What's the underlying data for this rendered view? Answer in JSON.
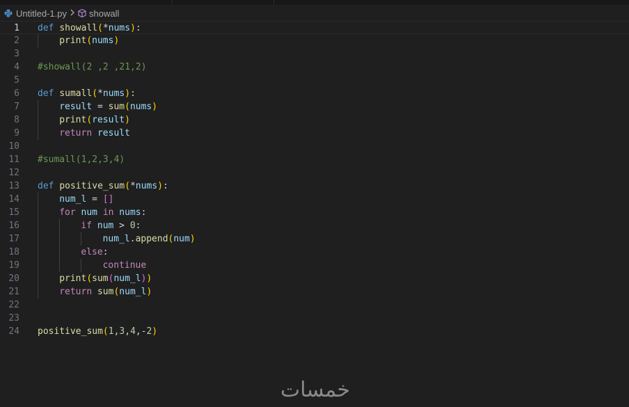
{
  "breadcrumb": {
    "file": "Untitled-1.py",
    "symbol": "showall"
  },
  "editor": {
    "current_line": 1,
    "lines": [
      {
        "n": "1",
        "tokens": [
          [
            "kw",
            "def"
          ],
          [
            "pl",
            " "
          ],
          [
            "fn",
            "showall"
          ],
          [
            "br1",
            "("
          ],
          [
            "pl",
            "*"
          ],
          [
            "var",
            "nums"
          ],
          [
            "br1",
            ")"
          ],
          [
            "pl",
            ":"
          ]
        ]
      },
      {
        "n": "2",
        "indent": 1,
        "tokens": [
          [
            "fn",
            "print"
          ],
          [
            "br1",
            "("
          ],
          [
            "var",
            "nums"
          ],
          [
            "br1",
            ")"
          ]
        ]
      },
      {
        "n": "3",
        "tokens": []
      },
      {
        "n": "4",
        "tokens": [
          [
            "cmt",
            "#showall(2 ,2 ,21,2)"
          ]
        ]
      },
      {
        "n": "5",
        "tokens": []
      },
      {
        "n": "6",
        "tokens": [
          [
            "kw",
            "def"
          ],
          [
            "pl",
            " "
          ],
          [
            "fn",
            "sumall"
          ],
          [
            "br1",
            "("
          ],
          [
            "pl",
            "*"
          ],
          [
            "var",
            "nums"
          ],
          [
            "br1",
            ")"
          ],
          [
            "pl",
            ":"
          ]
        ]
      },
      {
        "n": "7",
        "indent": 1,
        "tokens": [
          [
            "var",
            "result"
          ],
          [
            "pl",
            " = "
          ],
          [
            "fn",
            "sum"
          ],
          [
            "br1",
            "("
          ],
          [
            "var",
            "nums"
          ],
          [
            "br1",
            ")"
          ]
        ]
      },
      {
        "n": "8",
        "indent": 1,
        "tokens": [
          [
            "fn",
            "print"
          ],
          [
            "br1",
            "("
          ],
          [
            "var",
            "result"
          ],
          [
            "br1",
            ")"
          ]
        ]
      },
      {
        "n": "9",
        "indent": 1,
        "tokens": [
          [
            "ctl",
            "return"
          ],
          [
            "pl",
            " "
          ],
          [
            "var",
            "result"
          ]
        ]
      },
      {
        "n": "10",
        "tokens": []
      },
      {
        "n": "11",
        "tokens": [
          [
            "cmt",
            "#sumall(1,2,3,4)"
          ]
        ]
      },
      {
        "n": "12",
        "tokens": []
      },
      {
        "n": "13",
        "tokens": [
          [
            "kw",
            "def"
          ],
          [
            "pl",
            " "
          ],
          [
            "fn",
            "positive_sum"
          ],
          [
            "br1",
            "("
          ],
          [
            "pl",
            "*"
          ],
          [
            "var",
            "nums"
          ],
          [
            "br1",
            ")"
          ],
          [
            "pl",
            ":"
          ]
        ]
      },
      {
        "n": "14",
        "indent": 1,
        "tokens": [
          [
            "var",
            "num_l"
          ],
          [
            "pl",
            " = "
          ],
          [
            "br2",
            "[]"
          ]
        ]
      },
      {
        "n": "15",
        "indent": 1,
        "tokens": [
          [
            "ctl",
            "for"
          ],
          [
            "pl",
            " "
          ],
          [
            "var",
            "num"
          ],
          [
            "pl",
            " "
          ],
          [
            "ctl",
            "in"
          ],
          [
            "pl",
            " "
          ],
          [
            "var",
            "nums"
          ],
          [
            "pl",
            ":"
          ]
        ]
      },
      {
        "n": "16",
        "indent": 2,
        "tokens": [
          [
            "ctl",
            "if"
          ],
          [
            "pl",
            " "
          ],
          [
            "var",
            "num"
          ],
          [
            "pl",
            " > "
          ],
          [
            "num",
            "0"
          ],
          [
            "pl",
            ":"
          ]
        ]
      },
      {
        "n": "17",
        "indent": 3,
        "tokens": [
          [
            "var",
            "num_l"
          ],
          [
            "pl",
            "."
          ],
          [
            "fn",
            "append"
          ],
          [
            "br1",
            "("
          ],
          [
            "var",
            "num"
          ],
          [
            "br1",
            ")"
          ]
        ]
      },
      {
        "n": "18",
        "indent": 2,
        "tokens": [
          [
            "ctl",
            "else"
          ],
          [
            "pl",
            ":"
          ]
        ]
      },
      {
        "n": "19",
        "indent": 3,
        "tokens": [
          [
            "ctl",
            "continue"
          ]
        ]
      },
      {
        "n": "20",
        "indent": 1,
        "tokens": [
          [
            "fn",
            "print"
          ],
          [
            "br1",
            "("
          ],
          [
            "fn",
            "sum"
          ],
          [
            "br2",
            "("
          ],
          [
            "var",
            "num_l"
          ],
          [
            "br2",
            ")"
          ],
          [
            "br1",
            ")"
          ]
        ]
      },
      {
        "n": "21",
        "indent": 1,
        "tokens": [
          [
            "ctl",
            "return"
          ],
          [
            "pl",
            " "
          ],
          [
            "fn",
            "sum"
          ],
          [
            "br1",
            "("
          ],
          [
            "var",
            "num_l"
          ],
          [
            "br1",
            ")"
          ]
        ]
      },
      {
        "n": "22",
        "tokens": []
      },
      {
        "n": "23",
        "tokens": []
      },
      {
        "n": "24",
        "tokens": [
          [
            "fn",
            "positive_sum"
          ],
          [
            "br1",
            "("
          ],
          [
            "num",
            "1"
          ],
          [
            "pl",
            ","
          ],
          [
            "num",
            "3"
          ],
          [
            "pl",
            ","
          ],
          [
            "num",
            "4"
          ],
          [
            "pl",
            ",-"
          ],
          [
            "num",
            "2"
          ],
          [
            "br1",
            ")"
          ]
        ]
      }
    ]
  },
  "watermark": "خمسات",
  "colors": {
    "background": "#1f1f1f",
    "keyword": "#569cd6",
    "control": "#c586c0",
    "function": "#dcdcaa",
    "variable": "#9cdcfe",
    "number": "#b5cea8",
    "comment": "#6a9955"
  }
}
